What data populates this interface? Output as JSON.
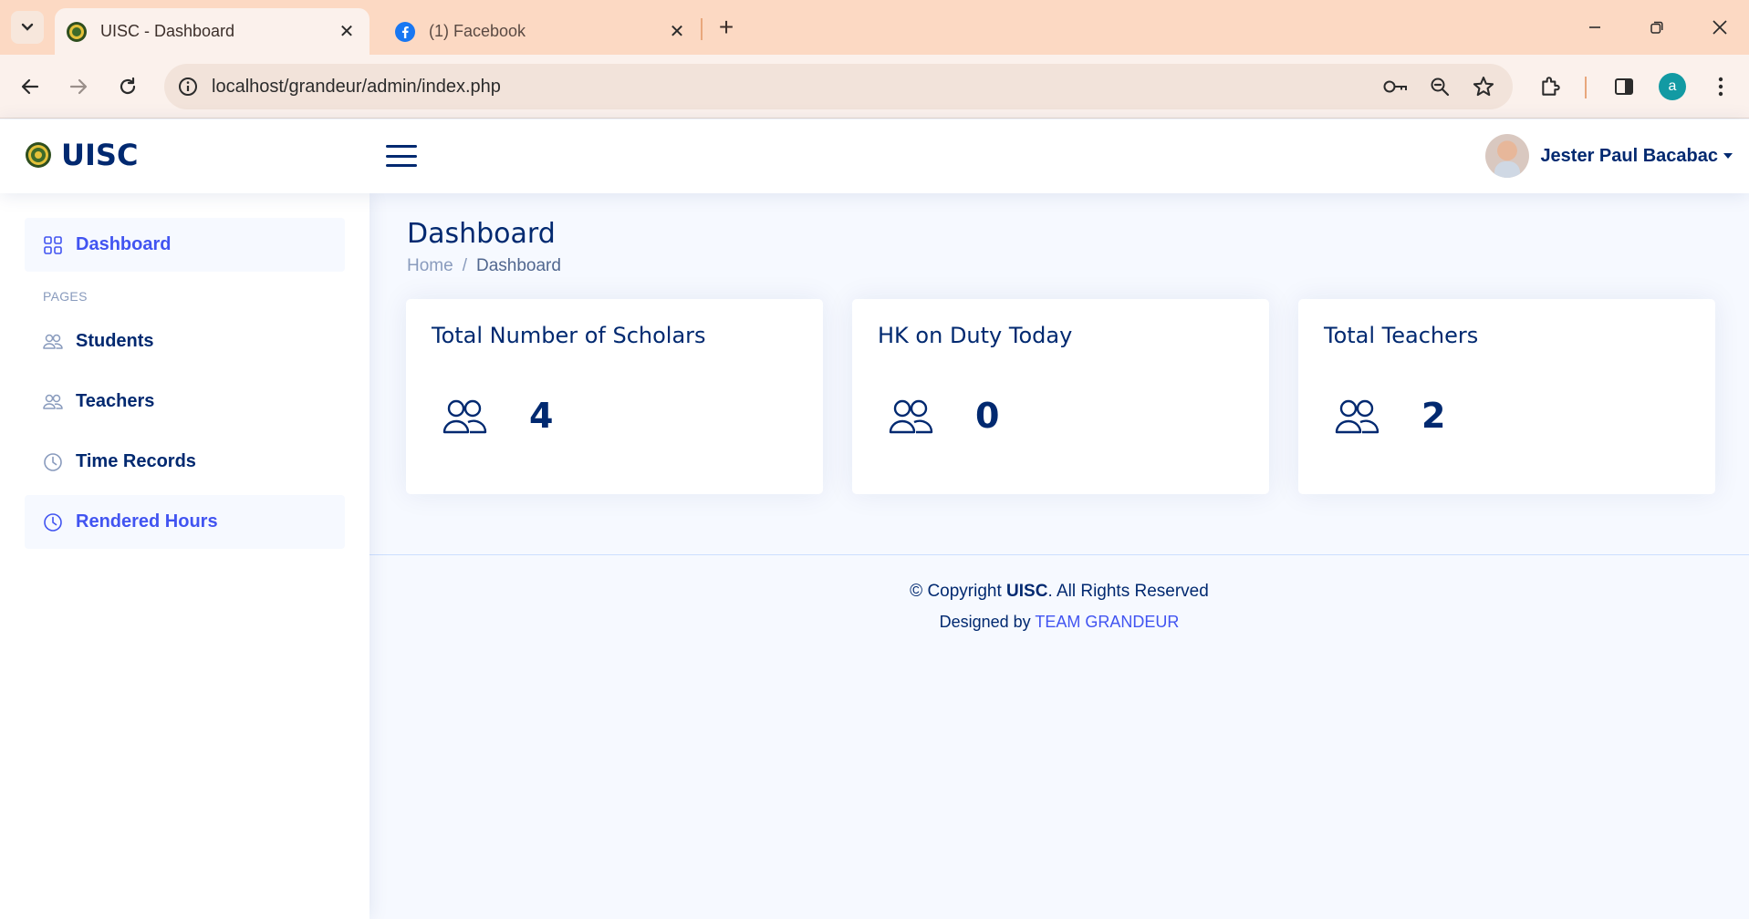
{
  "browser": {
    "tabs": [
      {
        "title": "UISC - Dashboard",
        "active": true
      },
      {
        "title": "(1) Facebook",
        "active": false
      }
    ],
    "url": "localhost/grandeur/admin/index.php",
    "profile_initial": "a"
  },
  "header": {
    "logo_text": "UISC",
    "user_name": "Jester Paul Bacabac"
  },
  "sidebar": {
    "items_top": [
      {
        "label": "Dashboard",
        "icon": "grid-icon",
        "active": true
      }
    ],
    "heading": "PAGES",
    "items": [
      {
        "label": "Students",
        "icon": "people-icon"
      },
      {
        "label": "Teachers",
        "icon": "people-icon"
      },
      {
        "label": "Time Records",
        "icon": "clock-icon"
      },
      {
        "label": "Rendered Hours",
        "icon": "clock-icon"
      }
    ]
  },
  "page": {
    "title": "Dashboard",
    "breadcrumb": {
      "home": "Home",
      "separator": "/",
      "current": "Dashboard"
    }
  },
  "cards": [
    {
      "title": "Total Number of Scholars",
      "value": "4",
      "icon": "people-icon"
    },
    {
      "title": "HK on Duty Today",
      "value": "0",
      "icon": "people-icon"
    },
    {
      "title": "Total Teachers",
      "value": "2",
      "icon": "people-icon"
    }
  ],
  "footer": {
    "copyright_prefix": "© Copyright ",
    "copyright_brand": "UISC",
    "copyright_suffix": ". All Rights Reserved",
    "designed_prefix": "Designed by ",
    "designed_link": "TEAM GRANDEUR"
  },
  "colors": {
    "brand": "#012970",
    "accent": "#4154f1",
    "muted": "#899bbd",
    "background": "#f6f9ff",
    "tabbar": "#fcd9c3"
  }
}
